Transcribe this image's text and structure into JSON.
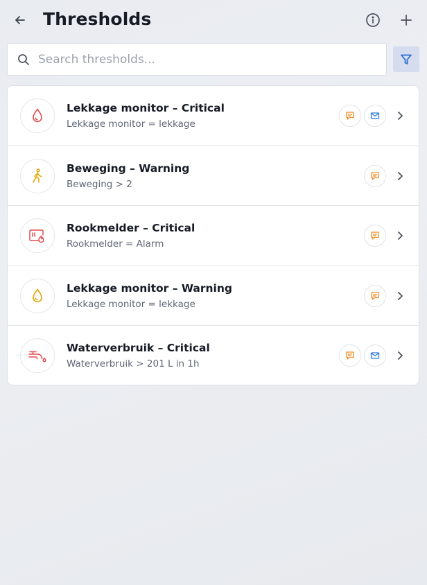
{
  "header": {
    "title": "Thresholds",
    "icons": {
      "back": "arrow-left-icon",
      "info": "info-circle-icon",
      "add": "plus-icon"
    }
  },
  "search": {
    "placeholder": "Search thresholds...",
    "value": "",
    "icon": "search-icon"
  },
  "filter": {
    "icon": "filter-icon",
    "active_color": "#2a6bd6"
  },
  "colors": {
    "critical": "#e5484d",
    "warning": "#e2a500",
    "sms_icon": "#f08a24",
    "mail_icon": "#2a7ad6"
  },
  "thresholds": [
    {
      "title": "Lekkage monitor – Critical",
      "condition": "Lekkage monitor = lekkage",
      "icon": "water-drop-icon",
      "severity": "critical",
      "channels": [
        "sms",
        "mail"
      ]
    },
    {
      "title": "Beweging – Warning",
      "condition": "Beweging > 2",
      "icon": "walking-person-icon",
      "severity": "warning",
      "channels": [
        "sms"
      ]
    },
    {
      "title": "Rookmelder – Critical",
      "condition": "Rookmelder = Alarm",
      "icon": "smoke-detector-icon",
      "severity": "critical",
      "channels": [
        "sms"
      ]
    },
    {
      "title": "Lekkage monitor – Warning",
      "condition": "Lekkage monitor = lekkage",
      "icon": "water-drop-icon",
      "severity": "warning",
      "channels": [
        "sms"
      ]
    },
    {
      "title": "Waterverbruik – Critical",
      "condition": "Waterverbruik > 201 L in 1h",
      "icon": "water-tap-icon",
      "severity": "critical",
      "channels": [
        "sms",
        "mail"
      ]
    }
  ]
}
